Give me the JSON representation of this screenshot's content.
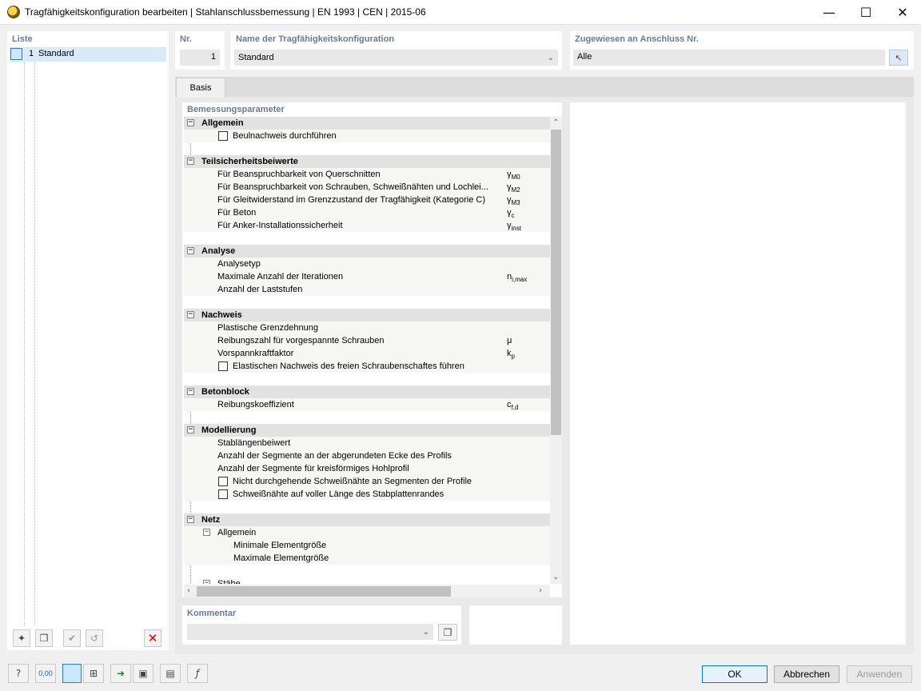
{
  "window": {
    "title": "Tragfähigkeitskonfiguration bearbeiten | Stahlanschlussbemessung | EN 1993 | CEN | 2015-06",
    "controls": {
      "minimize": "—",
      "maximize": "☐",
      "close": "✕"
    }
  },
  "list": {
    "header": "Liste",
    "items": [
      {
        "num": "1",
        "name": "Standard"
      }
    ]
  },
  "config": {
    "nr_label": "Nr.",
    "nr_value": "1",
    "name_label": "Name der Tragfähigkeitskonfiguration",
    "name_value": "Standard",
    "assigned_label": "Zugewiesen an Anschluss Nr.",
    "assigned_value": "Alle"
  },
  "tabs": [
    {
      "label": "Basis",
      "active": true
    }
  ],
  "params": {
    "header": "Bemessungsparameter",
    "groups": {
      "allgemein": {
        "title": "Allgemein",
        "beulnachweis": "Beulnachweis durchführen"
      },
      "teilsicherheit": {
        "title": "Teilsicherheitsbeiwerte",
        "r1": {
          "label": "Für Beanspruchbarkeit von Querschnitten",
          "sym": "γ",
          "sub": "M0"
        },
        "r2": {
          "label": "Für Beanspruchbarkeit von Schrauben, Schweißnähten und Lochlei...",
          "sym": "γ",
          "sub": "M2"
        },
        "r3": {
          "label": "Für Gleitwiderstand im Grenzzustand der Tragfähigkeit (Kategorie C)",
          "sym": "γ",
          "sub": "M3"
        },
        "r4": {
          "label": "Für Beton",
          "sym": "γ",
          "sub": "c"
        },
        "r5": {
          "label": "Für Anker-Installationssicherheit",
          "sym": "γ",
          "sub": "inst"
        }
      },
      "analyse": {
        "title": "Analyse",
        "r1": "Analysetyp",
        "r2": {
          "label": "Maximale Anzahl der Iterationen",
          "sym": "n",
          "sub": "i,max"
        },
        "r3": "Anzahl der Laststufen"
      },
      "nachweis": {
        "title": "Nachweis",
        "r1": "Plastische Grenzdehnung",
        "r2": {
          "label": "Reibungszahl für vorgespannte Schrauben",
          "sym": "μ",
          "sub": ""
        },
        "r3": {
          "label": "Vorspannkraftfaktor",
          "sym": "k",
          "sub": "p"
        },
        "r4": "Elastischen Nachweis des freien Schraubenschaftes führen"
      },
      "betonblock": {
        "title": "Betonblock",
        "r1": {
          "label": "Reibungskoeffizient",
          "sym": "c",
          "sub": "f,d"
        }
      },
      "modellierung": {
        "title": "Modellierung",
        "r1": "Stablängenbeiwert",
        "r2": "Anzahl der Segmente an der abgerundeten Ecke des Profils",
        "r3": "Anzahl der Segmente für kreisförmiges Hohlprofil",
        "r4": "Nicht durchgehende Schweißnähte an Segmenten der Profile",
        "r5": "Schweißnähte auf voller Länge des Stabplattenrandes"
      },
      "netz": {
        "title": "Netz",
        "sub_allgemein": "Allgemein",
        "r1": "Minimale Elementgröße",
        "r2": "Maximale Elementgröße",
        "sub_staebe": "Stäbe"
      }
    }
  },
  "comment": {
    "label": "Kommentar",
    "value": ""
  },
  "buttons": {
    "ok": "OK",
    "cancel": "Abbrechen",
    "apply": "Anwenden"
  },
  "icons": {
    "new": "new-item-icon",
    "copy": "copy-icon",
    "check_all": "check-all-icon",
    "uncheck_all": "uncheck-all-icon",
    "delete": "delete-icon"
  },
  "bottom_toolbar": {
    "units_label": "0,00"
  }
}
